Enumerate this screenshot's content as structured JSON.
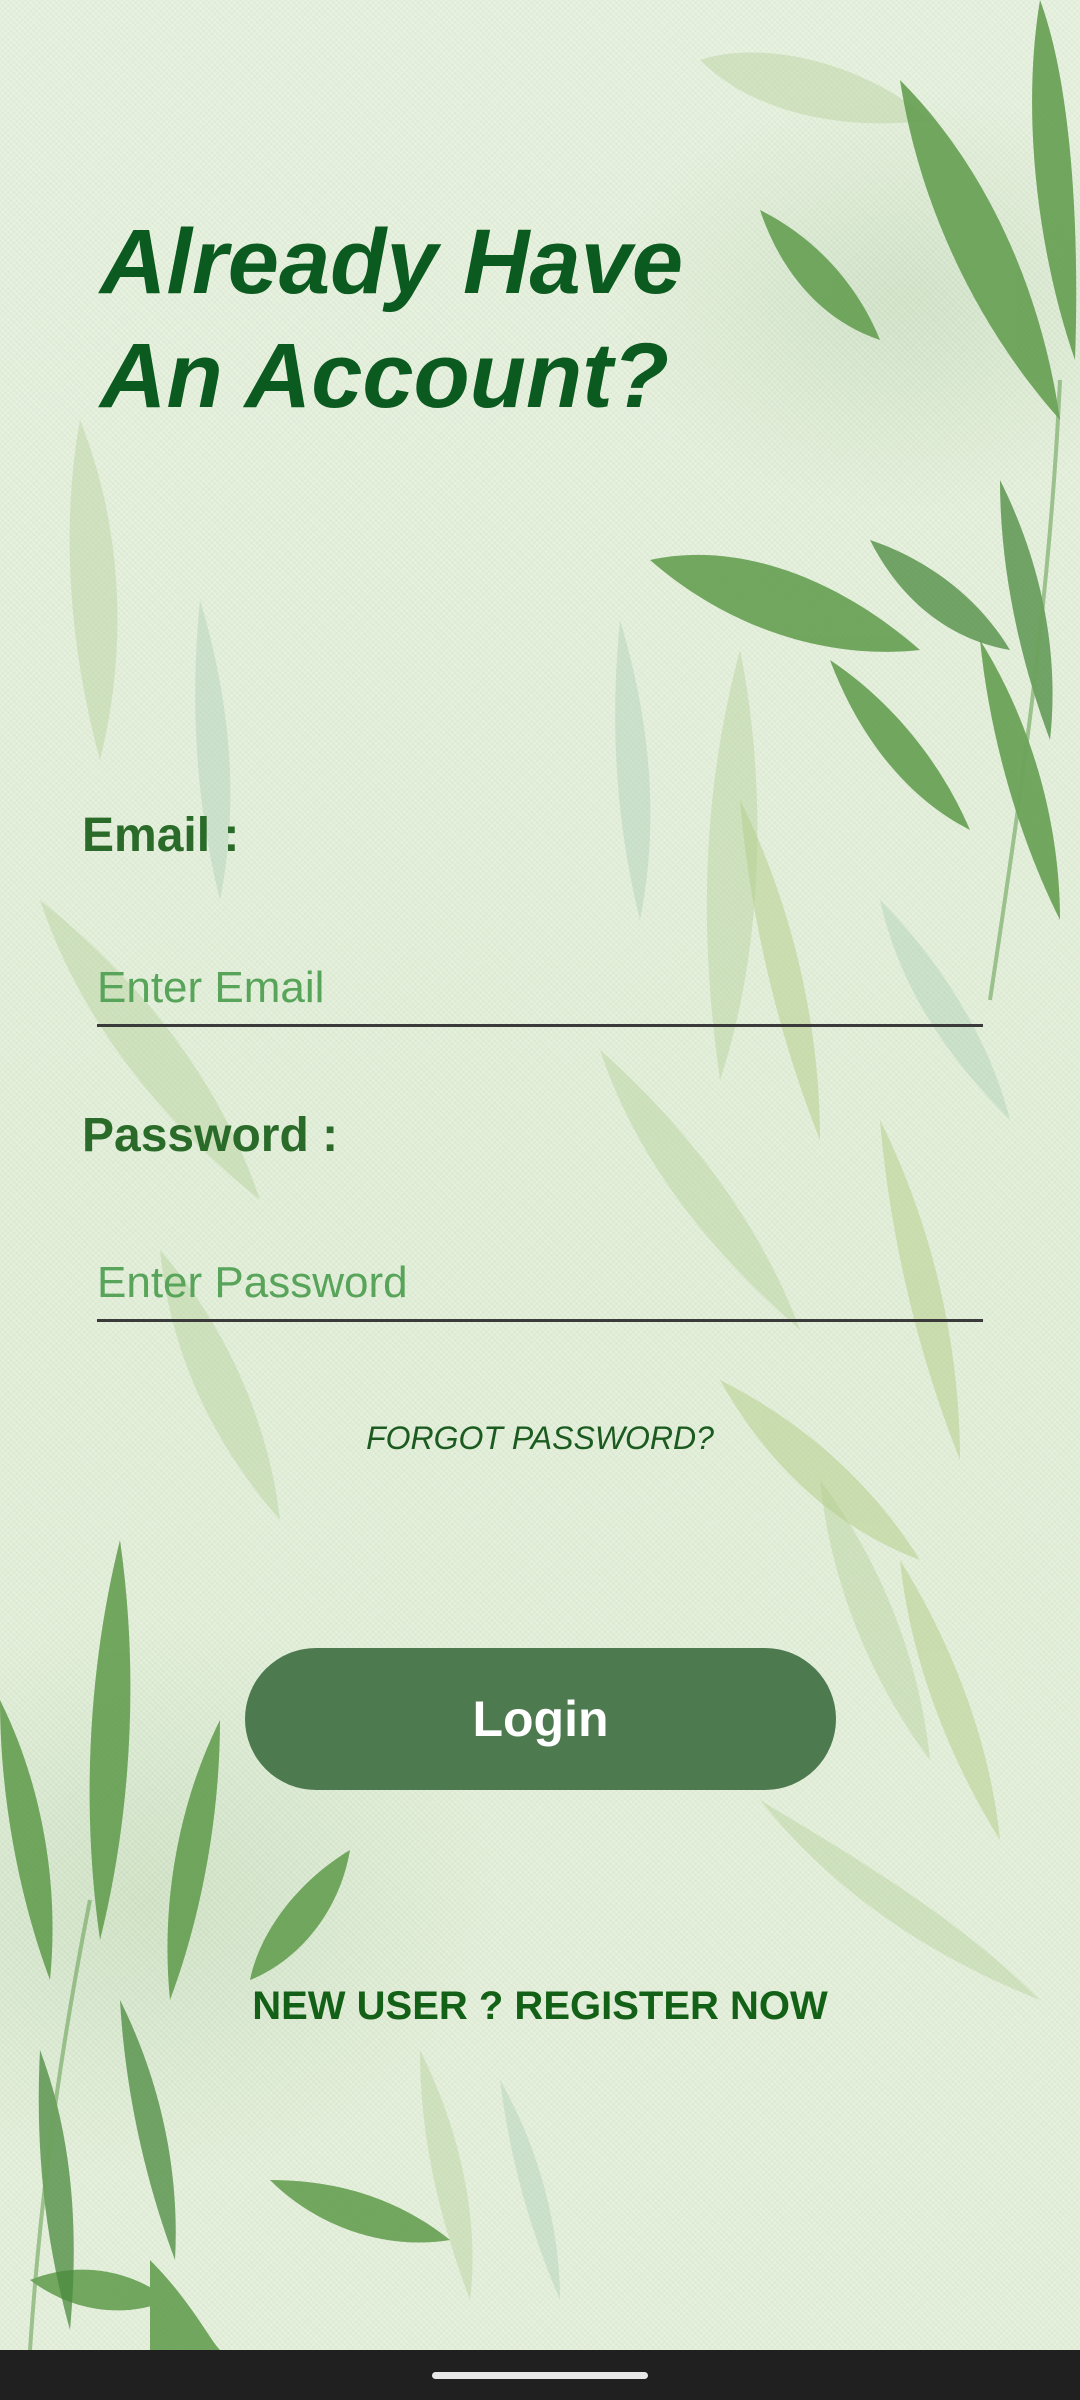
{
  "title": {
    "line1": "Already Have",
    "line2": "An Account?"
  },
  "form": {
    "email_label": "Email :",
    "email_placeholder": "Enter Email",
    "email_value": "",
    "password_label": "Password :",
    "password_placeholder": "Enter Password",
    "password_value": "",
    "forgot_label": "FORGOT PASSWORD?",
    "login_label": "Login",
    "register_label": "NEW USER ? REGISTER NOW"
  },
  "colors": {
    "title": "#0b5a1f",
    "label": "#2b6b2a",
    "placeholder": "#57a45a",
    "button": "#4e7a50",
    "background": "#e3f0d9",
    "navbar": "#202020"
  }
}
